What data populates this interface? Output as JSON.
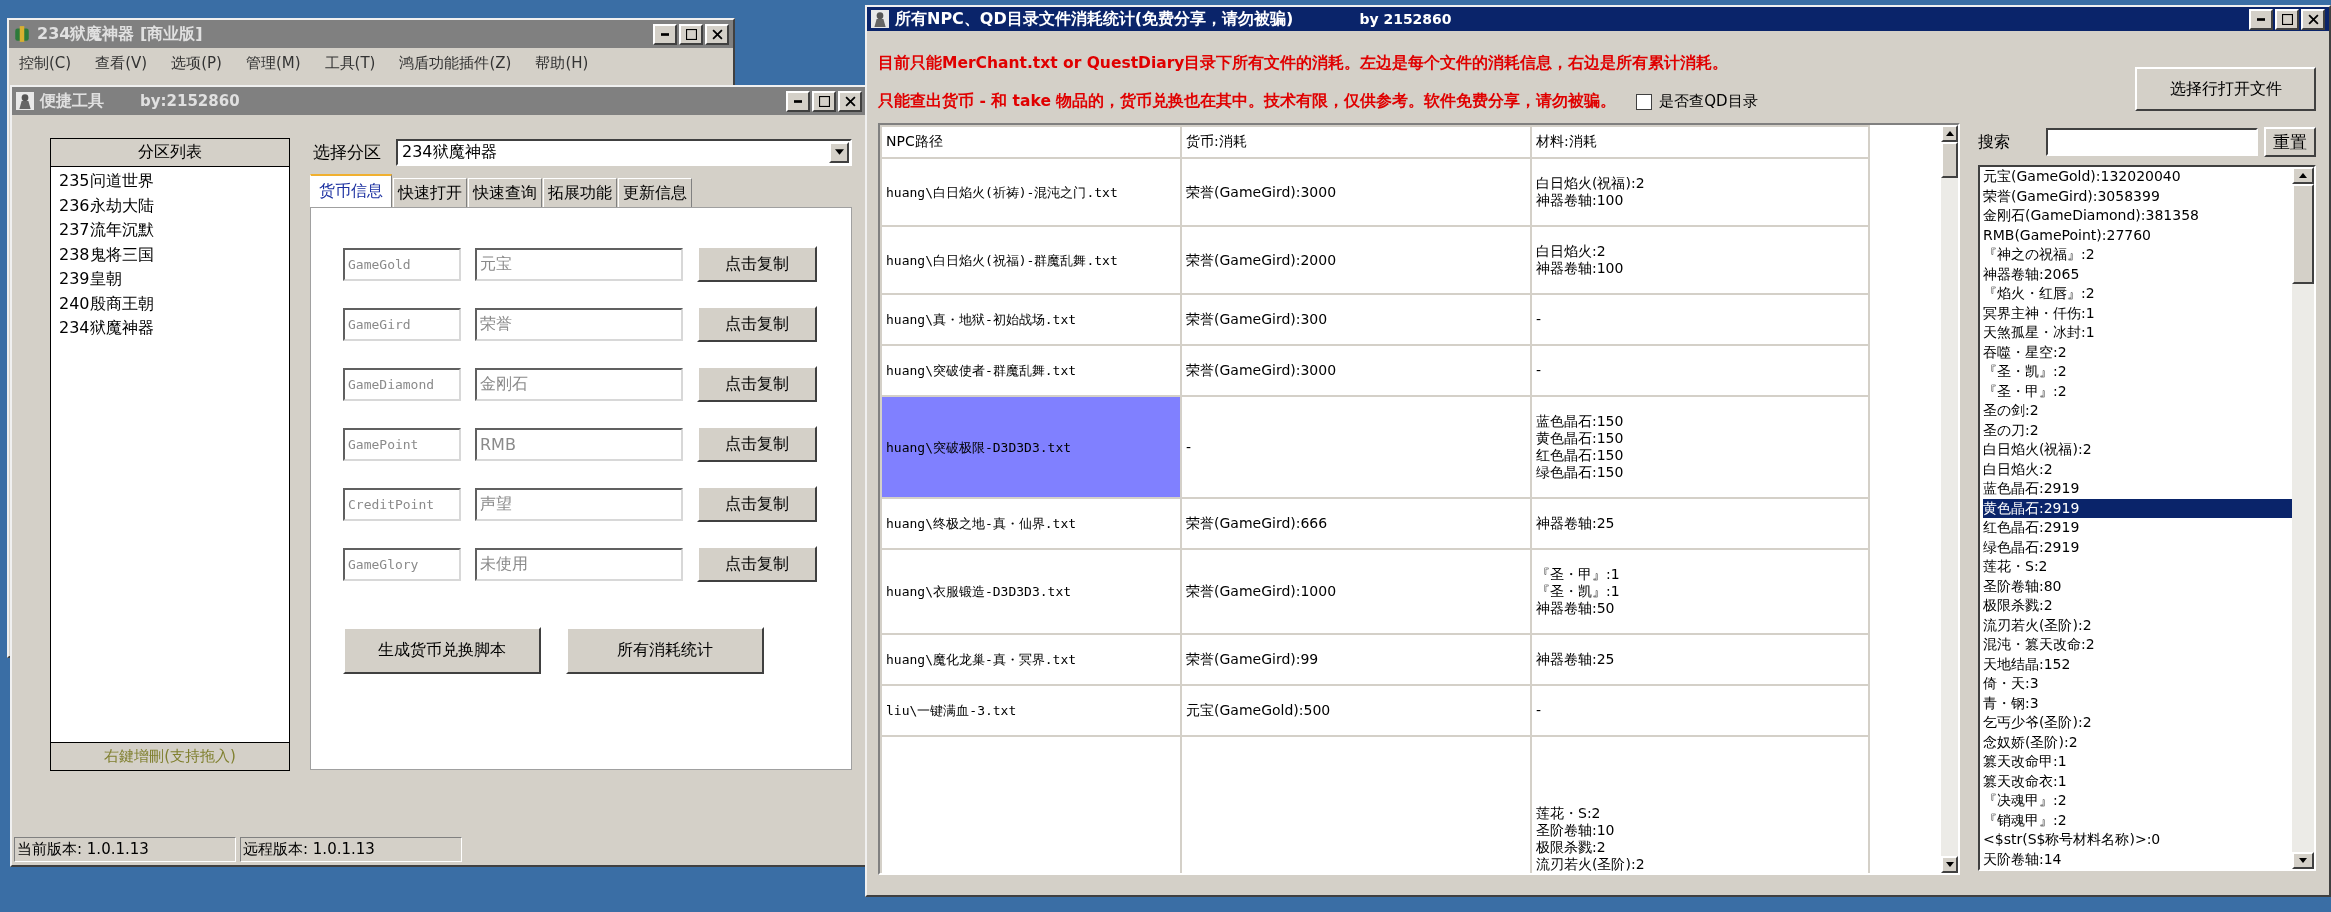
{
  "back_window": {
    "title": "234狱魔神器 [商业版]",
    "menu": [
      "控制(C)",
      "查看(V)",
      "选项(P)",
      "管理(M)",
      "工具(T)",
      "鸿盾功能插件(Z)",
      "帮助(H)"
    ]
  },
  "tool_window": {
    "title": "便捷工具",
    "author": "by:2152860",
    "zone_list": {
      "header": "分区列表",
      "items": [
        "235问道世界",
        "236永劫大陆",
        "237流年沉默",
        "238鬼将三国",
        "239皇朝",
        "240殷商王朝",
        "234狱魔神器"
      ],
      "footer": "右鍵增刪(支持拖入)"
    },
    "zone_select": {
      "label": "选择分区",
      "value": "234狱魔神器"
    },
    "tabs": [
      {
        "label": "货币信息",
        "selected": true
      },
      {
        "label": "快速打开",
        "selected": false
      },
      {
        "label": "快速查询",
        "selected": false
      },
      {
        "label": "拓展功能",
        "selected": false
      },
      {
        "label": "更新信息",
        "selected": false
      }
    ],
    "currencies": [
      {
        "key": "GameGold",
        "name": "元宝",
        "button": "点击复制"
      },
      {
        "key": "GameGird",
        "name": "荣誉",
        "button": "点击复制"
      },
      {
        "key": "GameDiamond",
        "name": "金刚石",
        "button": "点击复制"
      },
      {
        "key": "GamePoint",
        "name": "RMB",
        "button": "点击复制"
      },
      {
        "key": "CreditPoint",
        "name": "声望",
        "button": "点击复制"
      },
      {
        "key": "GameGlory",
        "name": "未使用",
        "button": "点击复制"
      }
    ],
    "actions": [
      "生成货币兑换脚本",
      "所有消耗统计"
    ],
    "status_bar": [
      "当前版本: 1.0.1.13",
      "远程版本: 1.0.1.13"
    ]
  },
  "stats_window": {
    "title": "所有NPC、QD目录文件消耗统计(免费分享，请勿被骗)",
    "author": "by 2152860",
    "notices": [
      "目前只能MerChant.txt or QuestDiary目录下所有文件的消耗。左边是每个文件的消耗信息，右边是所有累计消耗。",
      "只能查出货币 - 和 take 物品的，货币兑换也在其中。技术有限，仅供参考。软件免费分享，请勿被骗。"
    ],
    "qd_checkbox": {
      "label": "是否查QD目录",
      "checked": false
    },
    "open_button": "选择行打开文件",
    "table": {
      "columns": [
        "NPC路径",
        "货币:消耗",
        "材料:消耗"
      ],
      "rows": [
        {
          "path": "huang\\白日焰火(祈祷)-混沌之门.txt",
          "currency": "荣誉(GameGird):3000",
          "materials": [
            "白日焰火(祝福):2",
            "神器卷轴:100"
          ],
          "selected": false
        },
        {
          "path": "huang\\白日焰火(祝福)-群魔乱舞.txt",
          "currency": "荣誉(GameGird):2000",
          "materials": [
            "白日焰火:2",
            "神器卷轴:100"
          ],
          "selected": false
        },
        {
          "path": "huang\\真・地狱-初始战场.txt",
          "currency": "荣誉(GameGird):300",
          "materials": [
            "-"
          ],
          "selected": false
        },
        {
          "path": "huang\\突破使者-群魔乱舞.txt",
          "currency": "荣誉(GameGird):3000",
          "materials": [
            "-"
          ],
          "selected": false
        },
        {
          "path": "huang\\突破极限-D3D3D3.txt",
          "currency": "-",
          "materials": [
            "蓝色晶石:150",
            "黄色晶石:150",
            "红色晶石:150",
            "绿色晶石:150"
          ],
          "selected": true
        },
        {
          "path": "huang\\终极之地-真・仙界.txt",
          "currency": "荣誉(GameGird):666",
          "materials": [
            "神器卷轴:25"
          ],
          "selected": false
        },
        {
          "path": "huang\\衣服锻造-D3D3D3.txt",
          "currency": "荣誉(GameGird):1000",
          "materials": [
            "『圣・甲』:1",
            "『圣・凯』:1",
            "神器卷轴:50"
          ],
          "selected": false
        },
        {
          "path": "huang\\魔化龙巢-真・冥界.txt",
          "currency": "荣誉(GameGird):99",
          "materials": [
            "神器卷轴:25"
          ],
          "selected": false
        },
        {
          "path": "liu\\一键满血-3.txt",
          "currency": "元宝(GameGold):500",
          "materials": [
            "-"
          ],
          "selected": false
        },
        {
          "materials": [
            "莲花・S:2",
            "圣阶卷轴:10",
            "极限杀戮:2",
            "流刃若火(圣阶):2"
          ],
          "selected": false
        }
      ]
    },
    "search": {
      "label": "搜索",
      "button": "重置"
    },
    "totals": [
      {
        "label": "元宝(GameGold):132020040",
        "selected": false
      },
      {
        "label": "荣誉(GameGird):3058399",
        "selected": false
      },
      {
        "label": "金刚石(GameDiamond):381358",
        "selected": false
      },
      {
        "label": "RMB(GamePoint):27760",
        "selected": false
      },
      {
        "label": "『神之の祝福』:2",
        "selected": false
      },
      {
        "label": "神器卷轴:2065",
        "selected": false
      },
      {
        "label": "『焰火・红唇』:2",
        "selected": false
      },
      {
        "label": "冥界主神・仟伤:1",
        "selected": false
      },
      {
        "label": "天煞孤星・冰封:1",
        "selected": false
      },
      {
        "label": "吞噬・星空:2",
        "selected": false
      },
      {
        "label": "『圣・凯』:2",
        "selected": false
      },
      {
        "label": "『圣・甲』:2",
        "selected": false
      },
      {
        "label": "圣の剑:2",
        "selected": false
      },
      {
        "label": "圣の刀:2",
        "selected": false
      },
      {
        "label": "白日焰火(祝福):2",
        "selected": false
      },
      {
        "label": "白日焰火:2",
        "selected": false
      },
      {
        "label": "蓝色晶石:2919",
        "selected": false
      },
      {
        "label": "黄色晶石:2919",
        "selected": true
      },
      {
        "label": "红色晶石:2919",
        "selected": false
      },
      {
        "label": "绿色晶石:2919",
        "selected": false
      },
      {
        "label": "莲花・S:2",
        "selected": false
      },
      {
        "label": "圣阶卷轴:80",
        "selected": false
      },
      {
        "label": "极限杀戮:2",
        "selected": false
      },
      {
        "label": "流刃若火(圣阶):2",
        "selected": false
      },
      {
        "label": "混沌・篡天改命:2",
        "selected": false
      },
      {
        "label": "天地结晶:152",
        "selected": false
      },
      {
        "label": "倚・天:3",
        "selected": false
      },
      {
        "label": "青・钢:3",
        "selected": false
      },
      {
        "label": "乞丐少爷(圣阶):2",
        "selected": false
      },
      {
        "label": "念奴娇(圣阶):2",
        "selected": false
      },
      {
        "label": "篡天改命甲:1",
        "selected": false
      },
      {
        "label": "篡天改命衣:1",
        "selected": false
      },
      {
        "label": "『决魂甲』:2",
        "selected": false
      },
      {
        "label": "『销魂甲』:2",
        "selected": false
      },
      {
        "label": "<$str(S$称号材料名称)>:0",
        "selected": false
      },
      {
        "label": "天阶卷轴:14",
        "selected": false
      }
    ]
  }
}
